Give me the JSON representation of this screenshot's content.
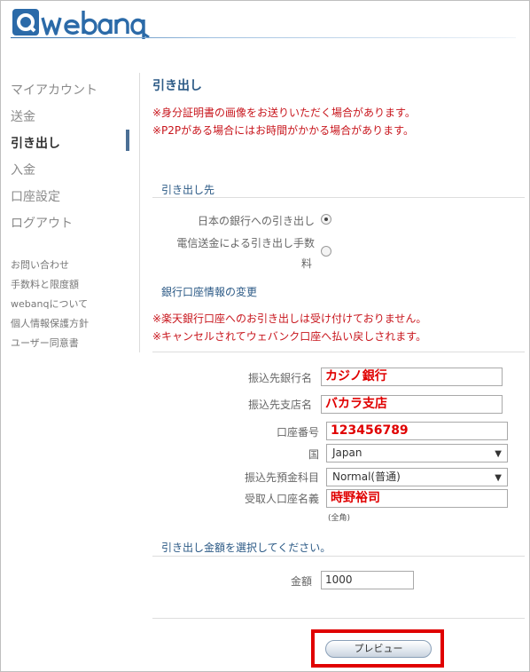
{
  "brand": {
    "name": "webanq",
    "accent": "#2b6aa8"
  },
  "sidebar": {
    "items": [
      {
        "label": "マイアカウント"
      },
      {
        "label": "送金"
      },
      {
        "label": "引き出し"
      },
      {
        "label": "入金"
      },
      {
        "label": "口座設定"
      },
      {
        "label": "ログアウト"
      }
    ],
    "links": [
      {
        "label": "お問い合わせ"
      },
      {
        "label": "手数料と限度額"
      },
      {
        "label": "webanqについて"
      },
      {
        "label": "個人情報保護方針"
      },
      {
        "label": "ユーザー同意書"
      }
    ]
  },
  "main": {
    "title": "引き出し",
    "notices": [
      "※身分証明書の画像をお送りいただく場合があります。",
      "※P2Pがある場合にはお時間がかかる場合があります。"
    ],
    "destination": {
      "heading": "引き出し先",
      "options": [
        {
          "label": "日本の銀行への引き出し",
          "checked": true
        },
        {
          "label_line1": "電信送金による引き出し手数",
          "label_line2": "料",
          "checked": false
        }
      ]
    },
    "bank_change": {
      "heading": "銀行口座情報の変更",
      "notices": [
        "※楽天銀行口座へのお引き出しは受け付けておりません。",
        "※キャンセルされてウェバンク口座へ払い戻しされます。"
      ]
    },
    "form": {
      "bank_name": {
        "label": "振込先銀行名",
        "value": "カジノ銀行"
      },
      "branch_name": {
        "label": "振込先支店名",
        "value": "バカラ支店"
      },
      "account_number": {
        "label": "口座番号",
        "value": "123456789"
      },
      "country": {
        "label": "国",
        "value": "Japan"
      },
      "account_type": {
        "label": "振込先預金科目",
        "value": "Normal(普通)"
      },
      "holder_name": {
        "label": "受取人口座名義",
        "value": "時野裕司",
        "hint": "(全角)"
      }
    },
    "amount": {
      "heading": "引き出し金額を選択してください。",
      "label": "金額",
      "value": "1000"
    },
    "preview_label": "プレビュー"
  }
}
